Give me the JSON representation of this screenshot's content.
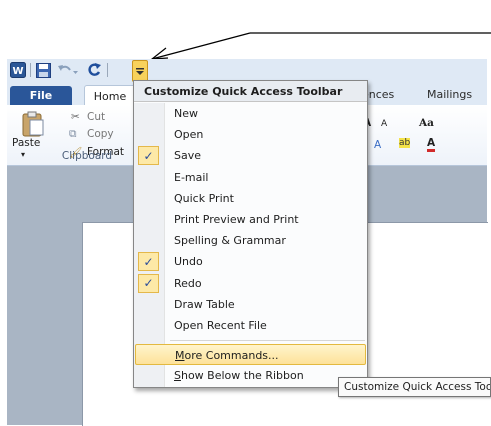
{
  "quick_access": {
    "icons": [
      "word-logo-icon",
      "save-icon",
      "undo-icon",
      "redo-icon",
      "customize-dropdown-icon"
    ],
    "highlight_color": "#f5c542"
  },
  "tabs": {
    "file": "File",
    "home": "Home",
    "references_partial": "ences",
    "mailings": "Mailings"
  },
  "ribbon": {
    "paste": "Paste",
    "cut": "Cut",
    "copy": "Copy",
    "format": "Format",
    "clipboard_group": "Clipboard",
    "font_size_up": "A",
    "font_size_down": "A",
    "change_case": "Aa"
  },
  "menu": {
    "title": "Customize Quick Access Toolbar",
    "items": [
      {
        "label": "New",
        "checked": false
      },
      {
        "label": "Open",
        "checked": false
      },
      {
        "label": "Save",
        "checked": true
      },
      {
        "label": "E-mail",
        "checked": false
      },
      {
        "label": "Quick Print",
        "checked": false
      },
      {
        "label": "Print Preview and Print",
        "checked": false
      },
      {
        "label": "Spelling & Grammar",
        "checked": false
      },
      {
        "label": "Undo",
        "checked": true
      },
      {
        "label": "Redo",
        "checked": true
      },
      {
        "label": "Draw Table",
        "checked": false
      },
      {
        "label": "Open Recent File",
        "checked": false
      }
    ],
    "more_commands": "More Commands...",
    "show_below": "Show Below the Ribbon",
    "check_glyph": "✓"
  },
  "tooltip": {
    "text": "Customize Quick Access Toolbar"
  }
}
